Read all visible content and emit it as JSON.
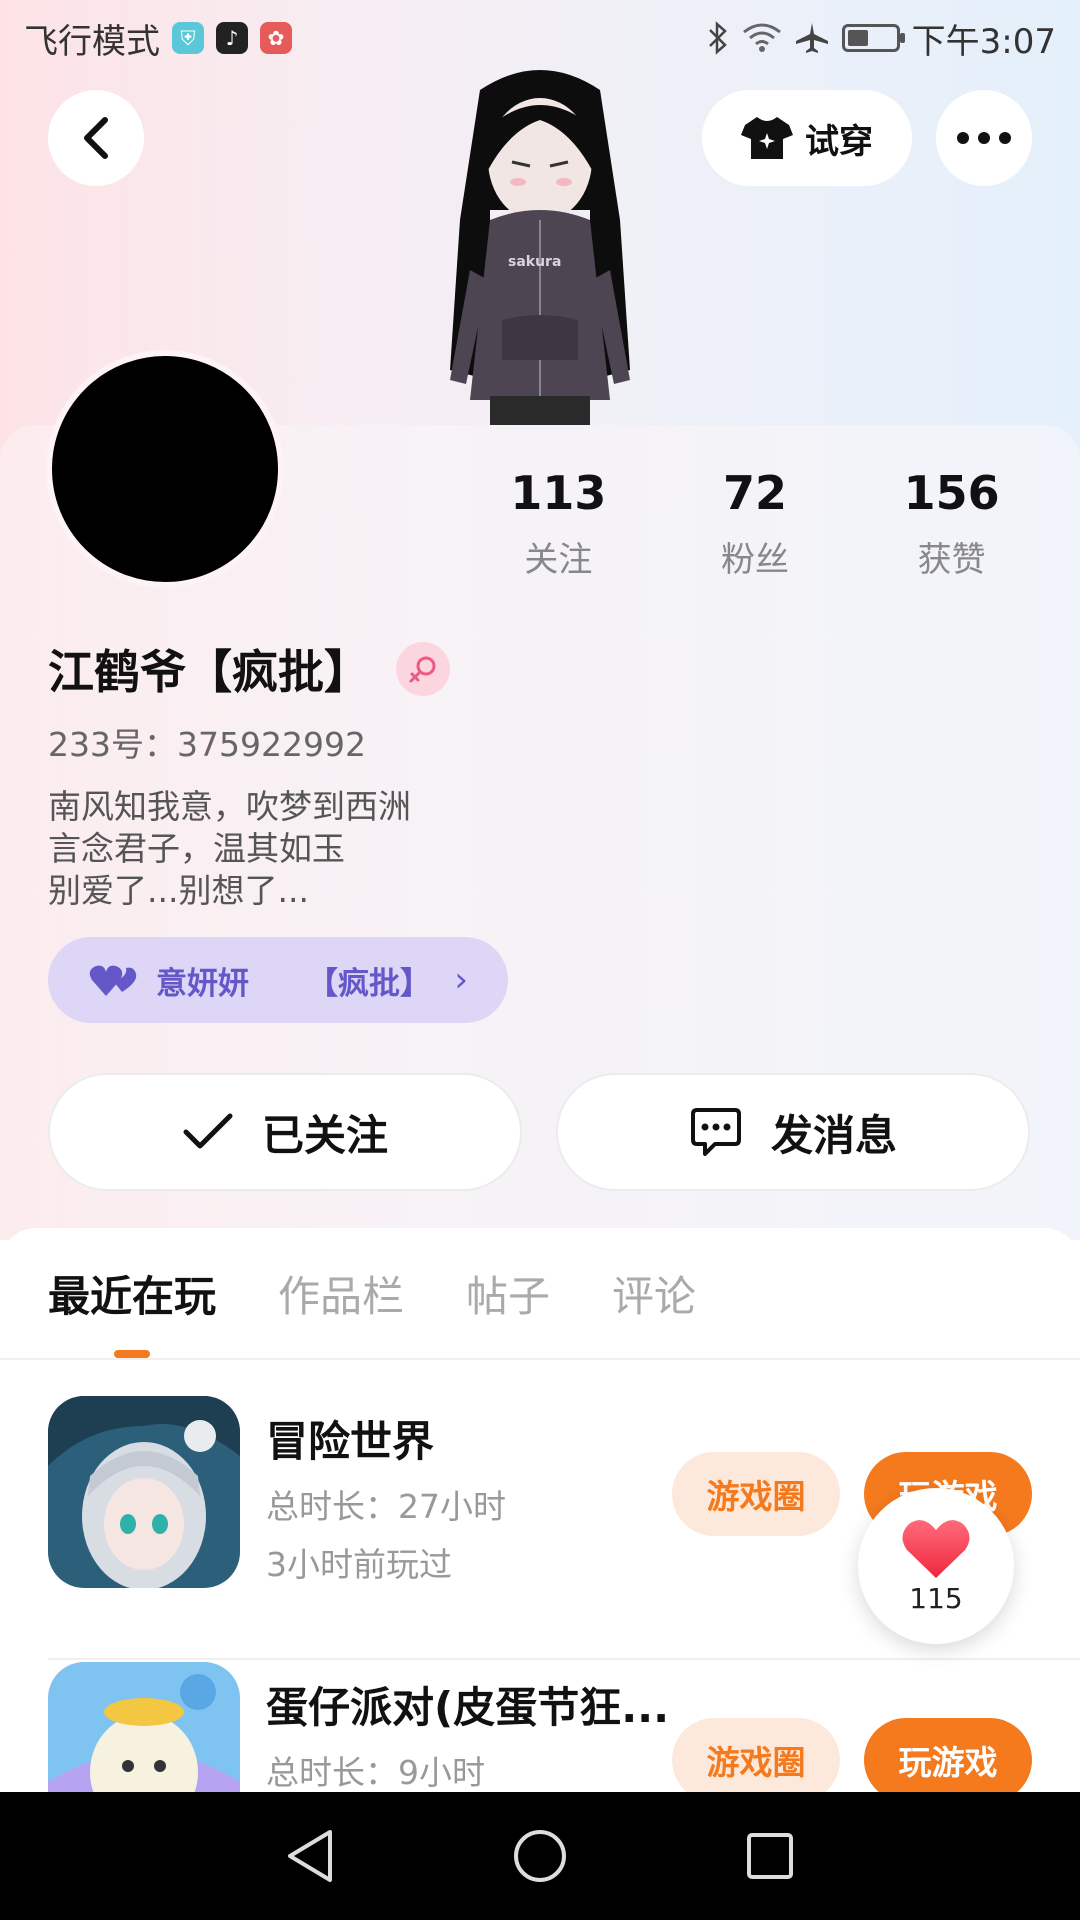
{
  "status_bar": {
    "left_text": "飞行模式",
    "time": "下午3:07",
    "icons": [
      "shield-app-icon",
      "tiktok-icon",
      "huawei-app-icon",
      "bluetooth-icon",
      "wifi-icon",
      "airplane-icon",
      "battery-icon"
    ]
  },
  "header": {
    "tryon_label": "试穿"
  },
  "stats": [
    {
      "value": "113",
      "label": "关注"
    },
    {
      "value": "72",
      "label": "粉丝"
    },
    {
      "value": "156",
      "label": "获赞"
    }
  ],
  "profile": {
    "username": "江鹤爷【疯批】",
    "user_id": "233号：375922992",
    "bio": [
      "南风知我意，吹梦到西洲",
      "言念君子，温其如玉",
      "别爱了...别想了..."
    ],
    "cp_name": "意妍妍",
    "cp_tag": "【疯批】",
    "hoodie_text": "sakura"
  },
  "actions": {
    "follow_label": "已关注",
    "message_label": "发消息"
  },
  "tabs": [
    {
      "label": "最近在玩",
      "active": true
    },
    {
      "label": "作品栏",
      "active": false
    },
    {
      "label": "帖子",
      "active": false
    },
    {
      "label": "评论",
      "active": false
    }
  ],
  "games": [
    {
      "title": "冒险世界",
      "duration": "总时长：27小时",
      "last_played": "3小时前玩过",
      "circle_label": "游戏圈",
      "play_label": "玩游戏"
    },
    {
      "title": "蛋仔派对(皮蛋节狂...",
      "duration": "总时长：9小时",
      "circle_label": "游戏圈",
      "play_label": "玩游戏"
    }
  ],
  "like_float": {
    "count": "115"
  },
  "colors": {
    "accent": "#f57a1e",
    "cp_tag_bg": "#ddd6f7",
    "cp_tag_text": "#6458c9"
  }
}
